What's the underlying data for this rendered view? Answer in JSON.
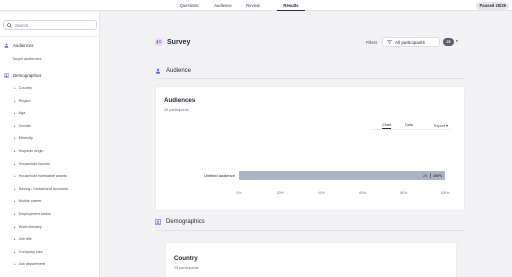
{
  "topnav": {
    "tabs": [
      {
        "label": "Questions"
      },
      {
        "label": "Audience"
      },
      {
        "label": "Review"
      },
      {
        "label": "Results"
      }
    ],
    "status_badge": "Paused 25/25"
  },
  "sidebar": {
    "search_placeholder": "Search",
    "audiences_heading": "Audiences",
    "target_audiences": "Target audiences",
    "demographics_heading": "Demographics",
    "items": [
      "Country",
      "Region",
      "Age",
      "Gender",
      "Ethnicity",
      "Hispanic origin",
      "Household income",
      "Household investable assets",
      "Saving / Investment accounts",
      "Mobile carrier",
      "Employment status",
      "Work industry",
      "Job title",
      "Company size",
      "Job department"
    ]
  },
  "header": {
    "title": "Survey",
    "filters_label": "Filters",
    "participants_button": "All participants",
    "count_badge": "25"
  },
  "audience_section": {
    "heading": "Audience",
    "card": {
      "title": "Audiences",
      "subtitle": "25 participants",
      "tabs": [
        "Chart",
        "Data"
      ],
      "export_label": "Export",
      "export_caret": "▾"
    }
  },
  "chart_data": {
    "type": "bar",
    "orientation": "horizontal",
    "categories": [
      "Untitled audience"
    ],
    "series": [
      {
        "values": [
          100
        ]
      }
    ],
    "data_labels": [
      {
        "count": "25",
        "percent": "100%"
      }
    ],
    "xlim": [
      0,
      100
    ],
    "x_ticks": [
      "0%",
      "20%",
      "40%",
      "60%",
      "80%",
      "100%"
    ],
    "bar_color": "#aab3c2"
  },
  "demographics_section": {
    "heading": "Demographics",
    "card": {
      "title": "Country",
      "subtitle": "25 participants"
    }
  },
  "colors": {
    "accent": "#2a2f3c",
    "icon_blue": "#5b6bd6",
    "survey_icon_bg": "#e9ddf5"
  }
}
